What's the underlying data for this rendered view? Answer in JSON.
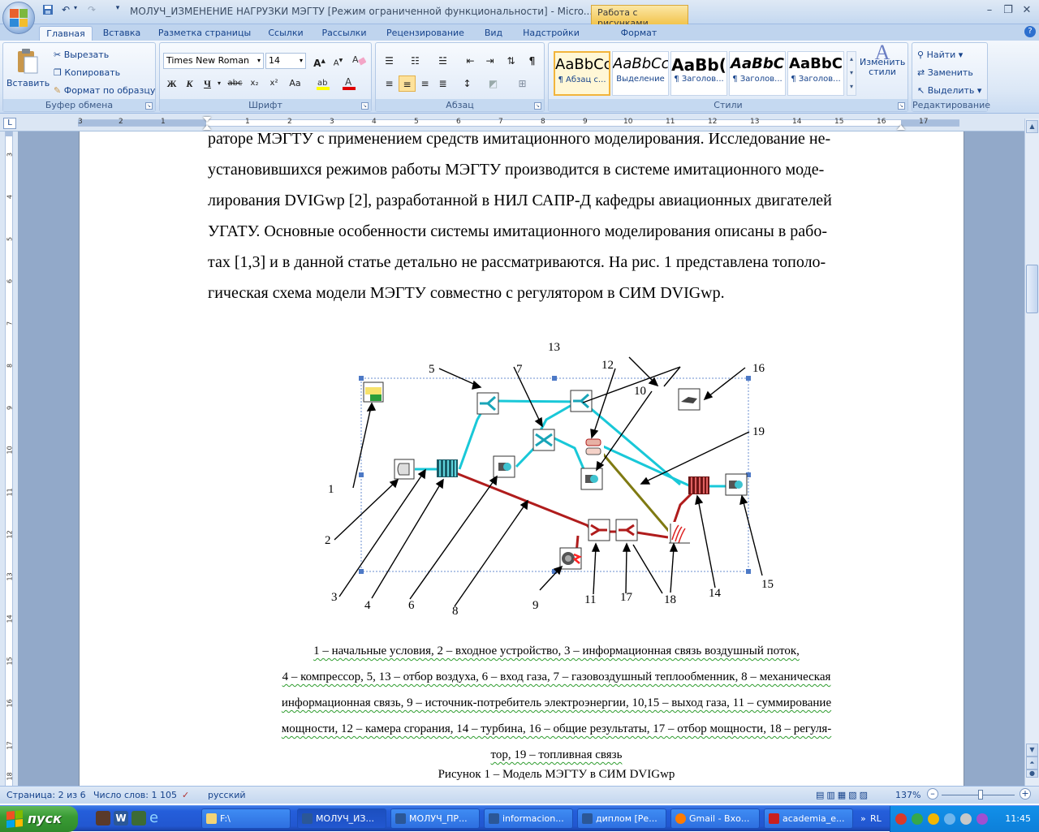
{
  "window": {
    "title": "МОЛУЧ_ИЗМЕНЕНИЕ НАГРУЗКИ МЭГТУ [Режим ограниченной функциональности] - Micro...",
    "contextual_tab": "Работа с рисунками"
  },
  "tabs": [
    "Главная",
    "Вставка",
    "Разметка страницы",
    "Ссылки",
    "Рассылки",
    "Рецензирование",
    "Вид",
    "Надстройки",
    "Формат"
  ],
  "ribbon": {
    "clipboard": {
      "paste": "Вставить",
      "cut": "Вырезать",
      "copy": "Копировать",
      "format_painter": "Формат по образцу",
      "label": "Буфер обмена"
    },
    "font": {
      "name": "Times New Roman",
      "size": "14",
      "label": "Шрифт",
      "bold": "Ж",
      "italic": "К",
      "underline": "Ч",
      "strike": "abc",
      "sub": "x₂",
      "sup": "x²",
      "case": "Aa"
    },
    "paragraph": {
      "label": "Абзац"
    },
    "styles": {
      "label": "Стили",
      "items": [
        {
          "sample": "AaBbCc",
          "name": "¶ Абзац с..."
        },
        {
          "sample": "AaBbCc",
          "name": "Выделение"
        },
        {
          "sample": "AaBb(",
          "name": "¶ Заголов..."
        },
        {
          "sample": "AaBbC",
          "name": "¶ Заголов..."
        },
        {
          "sample": "AaBbC",
          "name": "¶ Заголов..."
        }
      ],
      "change": "Изменить стили"
    },
    "editing": {
      "find": "Найти",
      "replace": "Заменить",
      "select": "Выделить",
      "label": "Редактирование"
    }
  },
  "ruler": {
    "h_numbers": [
      "3",
      "2",
      "1",
      "1",
      "2",
      "3",
      "4",
      "5",
      "6",
      "7",
      "8",
      "9",
      "10",
      "11",
      "12",
      "13",
      "14",
      "15",
      "16",
      "17"
    ],
    "v_numbers": [
      "3",
      "4",
      "5",
      "6",
      "7",
      "8",
      "9",
      "10",
      "11",
      "12",
      "13",
      "14",
      "15",
      "16",
      "17",
      "18"
    ]
  },
  "document": {
    "lines": [
      "раторе МЭГТУ с применением средств имитационного моделирования. Исследование не-",
      "установившихся режимов работы МЭГТУ производится в системе имитационного моде-",
      "лирования DVIGwp [2], разработанной в НИЛ САПР-Д кафедры авиационных двигателей",
      "УГАТУ. Основные особенности системы имитационного моделирования описаны в рабо-",
      "тах [1,3] и в данной статье детально не рассматриваются. На рис. 1 представлена тополо-",
      "гическая схема модели МЭГТУ  совместно с регулятором в СИМ DVIGwp."
    ],
    "figure_labels": [
      "1",
      "2",
      "3",
      "4",
      "5",
      "6",
      "7",
      "8",
      "9",
      "10",
      "11",
      "12",
      "13",
      "14",
      "15",
      "16",
      "17",
      "18",
      "19"
    ],
    "caption_lines": [
      "1 – начальные условия, 2 – входное устройство, 3 – информационная связь воздушный поток,",
      "4 – компрессор, 5, 13 – отбор воздуха, 6 – вход газа, 7 – газовоздушный теплообменник, 8 – механическая",
      "информационная связь, 9 – источник-потребитель электроэнергии, 10,15 – выход газа, 11 – суммирование",
      "мощности,  12 – камера сгорания, 14 – турбина, 16 – общие результаты, 17 – отбор мощности, 18 – регуля-",
      "тор, 19 – топливная связь"
    ],
    "figure_title": "Рисунок 1 – Модель МЭГТУ в СИМ DVIGwp"
  },
  "status": {
    "page": "Страница: 2 из 6",
    "words": "Число слов: 1 105",
    "language": "русский",
    "zoom": "137%"
  },
  "taskbar": {
    "start": "пуск",
    "tasks": [
      "F:\\",
      "МОЛУЧ_ИЗ...",
      "МОЛУЧ_ПР...",
      "informacion...",
      "диплом [Ре...",
      "Gmail - Вхо...",
      "academia_e..."
    ],
    "lang": "RL",
    "clock": "11:45"
  },
  "colors": {
    "air_link": "#19c8d8",
    "mech_link": "#b01c1c",
    "fuel_link": "#7f7a12",
    "accent": "#15428b"
  }
}
